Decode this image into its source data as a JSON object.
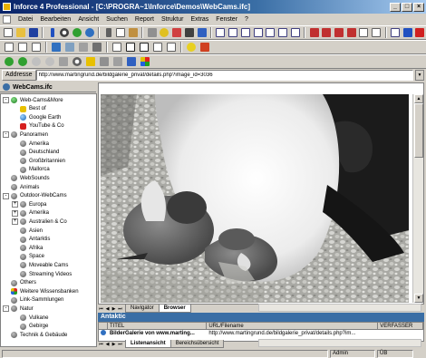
{
  "window": {
    "title": "Inforce 4 Professional - [C:\\PROGRA~1\\Inforce\\Demos\\WebCams.ifc]",
    "controls": [
      "_",
      "□",
      "×"
    ]
  },
  "menu": [
    "Datei",
    "Bearbeiten",
    "Ansicht",
    "Suchen",
    "Report",
    "Struktur",
    "Extras",
    "Fenster",
    "?"
  ],
  "address": {
    "label": "Addresse",
    "url": "http://www.martingrund.de/bildgalerie_privat/details.php?image_id=3036"
  },
  "panel": {
    "title": "WebCams.ifc"
  },
  "tree": [
    {
      "label": "Web-Cams&More",
      "depth": 0,
      "expander": "-",
      "icon": "web"
    },
    {
      "label": "Best of",
      "depth": 1,
      "expander": "",
      "icon": "star"
    },
    {
      "label": "Google Earth",
      "depth": 1,
      "expander": "",
      "icon": "globe"
    },
    {
      "label": "YouTube & Co",
      "depth": 1,
      "expander": "",
      "icon": "yt"
    },
    {
      "label": "Panoramen",
      "depth": 0,
      "expander": "-",
      "icon": "pin"
    },
    {
      "label": "Amerika",
      "depth": 1,
      "expander": "",
      "icon": "pin"
    },
    {
      "label": "Deutschland",
      "depth": 1,
      "expander": "",
      "icon": "pin"
    },
    {
      "label": "Großbritannien",
      "depth": 1,
      "expander": "",
      "icon": "pin"
    },
    {
      "label": "Mallorca",
      "depth": 1,
      "expander": "",
      "icon": "pin"
    },
    {
      "label": "WebSounds",
      "depth": 0,
      "expander": "",
      "icon": "pin"
    },
    {
      "label": "Animals",
      "depth": 0,
      "expander": "",
      "icon": "pin"
    },
    {
      "label": "Outdoor-WebCams",
      "depth": 0,
      "expander": "-",
      "icon": "pin"
    },
    {
      "label": "Europa",
      "depth": 1,
      "expander": "+",
      "icon": "pin"
    },
    {
      "label": "Amerika",
      "depth": 1,
      "expander": "+",
      "icon": "pin"
    },
    {
      "label": "Australien & Co",
      "depth": 1,
      "expander": "+",
      "icon": "pin"
    },
    {
      "label": "Asien",
      "depth": 1,
      "expander": "",
      "icon": "pin"
    },
    {
      "label": "Antarktis",
      "depth": 1,
      "expander": "",
      "icon": "pin"
    },
    {
      "label": "Afrika",
      "depth": 1,
      "expander": "",
      "icon": "pin"
    },
    {
      "label": "Space",
      "depth": 1,
      "expander": "",
      "icon": "pin"
    },
    {
      "label": "Moveable Cams",
      "depth": 1,
      "expander": "",
      "icon": "pin"
    },
    {
      "label": "Streaming Videos",
      "depth": 1,
      "expander": "",
      "icon": "pin"
    },
    {
      "label": "Others",
      "depth": 0,
      "expander": "",
      "icon": "pin"
    },
    {
      "label": "Weitere Wissensbanken",
      "depth": 0,
      "expander": "",
      "icon": "multi"
    },
    {
      "label": "Link-Sammlungen",
      "depth": 0,
      "expander": "",
      "icon": "pin"
    },
    {
      "label": "Natur",
      "depth": 0,
      "expander": "-",
      "icon": "pin"
    },
    {
      "label": "Vulkane",
      "depth": 1,
      "expander": "",
      "icon": "pin"
    },
    {
      "label": "Gebirge",
      "depth": 1,
      "expander": "",
      "icon": "pin"
    },
    {
      "label": "Technik & Gebäude",
      "depth": 0,
      "expander": "",
      "icon": "pin"
    }
  ],
  "browser_tabs": [
    {
      "label": "Navigator",
      "active": false
    },
    {
      "label": "Browser",
      "active": true
    }
  ],
  "bottom": {
    "title": "Antaktic",
    "columns": [
      "",
      "TITEL",
      "URL/Filename",
      "VERFASSER"
    ],
    "rows": [
      {
        "title": "BilderGalerie von www.marting...",
        "url": "http://www.martingrund.de/bildgalerie_privat/details.php?im..."
      }
    ],
    "tabs": [
      {
        "label": "Listenansicht",
        "active": true
      },
      {
        "label": "Bereichsübersicht",
        "active": false
      }
    ]
  },
  "status": {
    "user": "Admin",
    "mode": "ÜB"
  },
  "colors": {
    "title_bar": "#0a246a",
    "accent": "#3a6ea5",
    "face": "#d4d0c8"
  }
}
